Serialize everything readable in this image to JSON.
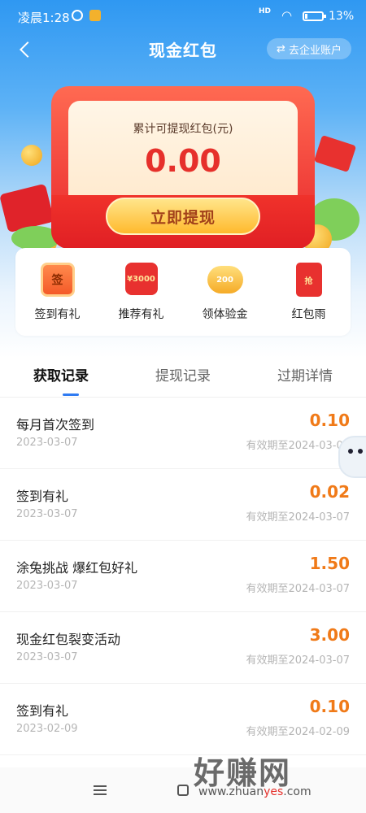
{
  "status_bar": {
    "time": "凌晨1:28",
    "network": "HD",
    "battery": "13%",
    "battery_level": 0.13
  },
  "header": {
    "title": "现金红包",
    "enterprise_button": "去企业账户"
  },
  "balance_card": {
    "label": "累计可提现红包(元)",
    "amount": "0.00",
    "withdraw_button": "立即提现"
  },
  "quick_actions": [
    {
      "label": "签到有礼",
      "icon": "sign-in-calendar-icon",
      "icon_text": "签"
    },
    {
      "label": "推荐有礼",
      "icon": "referral-voucher-icon",
      "icon_text": "¥3000"
    },
    {
      "label": "领体验金",
      "icon": "piggy-bank-icon",
      "icon_text": "200"
    },
    {
      "label": "红包雨",
      "icon": "red-envelope-icon",
      "icon_text": "抢"
    }
  ],
  "tabs": [
    {
      "label": "获取记录",
      "active": true
    },
    {
      "label": "提现记录",
      "active": false
    },
    {
      "label": "过期详情",
      "active": false
    }
  ],
  "records": [
    {
      "title": "每月首次签到",
      "date": "2023-03-07",
      "amount": "0.10",
      "expire": "有效期至2024-03-07"
    },
    {
      "title": "签到有礼",
      "date": "2023-03-07",
      "amount": "0.02",
      "expire": "有效期至2024-03-07"
    },
    {
      "title": "涂兔挑战 爆红包好礼",
      "date": "2023-03-07",
      "amount": "1.50",
      "expire": "有效期至2024-03-07"
    },
    {
      "title": "现金红包裂变活动",
      "date": "2023-03-07",
      "amount": "3.00",
      "expire": "有效期至2024-03-07"
    },
    {
      "title": "签到有礼",
      "date": "2023-02-09",
      "amount": "0.10",
      "expire": "有效期至2024-02-09"
    }
  ],
  "watermark": {
    "text": "好赚网",
    "url_prefix": "www.zhuan",
    "url_mid": "yes",
    "url_suffix": ".com"
  },
  "colors": {
    "header_blue": "#2f98f2",
    "card_red": "#e8262b",
    "amount_orange": "#f07a18",
    "tab_accent": "#2f7bf2"
  }
}
